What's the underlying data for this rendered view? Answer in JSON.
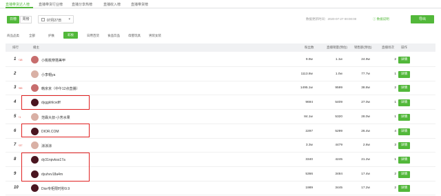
{
  "tabs": [
    "直播带货达人榜",
    "直播带货行业榜",
    "直播分享热榜",
    "直播收入榜",
    "直播带货榜"
  ],
  "toolbar": {
    "day_label": "日榜",
    "week_label": "周榜",
    "date_value": "07月27日",
    "updated_text": "数据更新时间：2020-07-27 00:00:00",
    "data_note": "ⓘ 数据说明",
    "export_label": "导出"
  },
  "categories": {
    "label": "商品品类",
    "items": [
      "全部",
      "护肤",
      "彩妆",
      "日用百货",
      "食品饮品",
      "母婴玩具",
      "男装女装"
    ]
  },
  "columns": [
    "排行",
    "播主",
    "粉丝数",
    "直播销量(预估)",
    "销售额(预估)",
    "直播场次",
    "操作"
  ],
  "rows": [
    {
      "rank": "1",
      "change": "↑18",
      "name": "小桃桃穿搭美甲",
      "fans": "9.9w",
      "sales": "1.1w",
      "revenue": "24.9w",
      "sessions": "2",
      "action": "详情"
    },
    {
      "rank": "2",
      "change": "",
      "name": "小李帽ya",
      "fans": "1113.8w",
      "sales": "1.0w",
      "revenue": "77.7w",
      "sessions": "1",
      "action": "详情"
    },
    {
      "rank": "3",
      "change": "↑55",
      "name": "韩京京（中午12点直播）",
      "fans": "1495.1w",
      "sales": "9599",
      "revenue": "38.8w",
      "sessions": "2",
      "action": "详情"
    },
    {
      "rank": "4",
      "change": "",
      "name": "dyggkhlcvdff",
      "fans": "9694",
      "sales": "5409",
      "revenue": "27.0w",
      "sessions": "1",
      "action": "详情"
    },
    {
      "rank": "5",
      "change": "↑1",
      "name": "范霖大叔-小芳水果",
      "fans": "84.1w",
      "sales": "5320",
      "revenue": "28.0w",
      "sessions": "1",
      "action": "详情"
    },
    {
      "rank": "6",
      "change": "",
      "name": "DIOR.COM",
      "fans": "2297",
      "sales": "5299",
      "revenue": "26.4w",
      "sessions": "4",
      "action": "详情"
    },
    {
      "rank": "7",
      "change": "↑37",
      "name": "涼涼涼",
      "fans": "3.3w",
      "sales": "4479",
      "revenue": "2.6w",
      "sessions": "3",
      "action": "详情"
    },
    {
      "rank": "8",
      "change": "",
      "name": "dy31npvkss17a",
      "fans": "3340",
      "sales": "4245",
      "revenue": "21.2w",
      "sessions": "1",
      "action": "详情"
    },
    {
      "rank": "9",
      "change": "",
      "name": "dyuhvv18a4m",
      "fans": "5366",
      "sales": "3484",
      "revenue": "17.4w",
      "sessions": "2",
      "action": "详情"
    },
    {
      "rank": "10",
      "change": "",
      "name": "Dior专柜限时秒9.9",
      "fans": "1989",
      "sales": "3445",
      "revenue": "17.2w",
      "sessions": "2",
      "action": "详情"
    }
  ],
  "colors": {
    "accent": "#52b83a",
    "highlight_box": "#e02020"
  }
}
